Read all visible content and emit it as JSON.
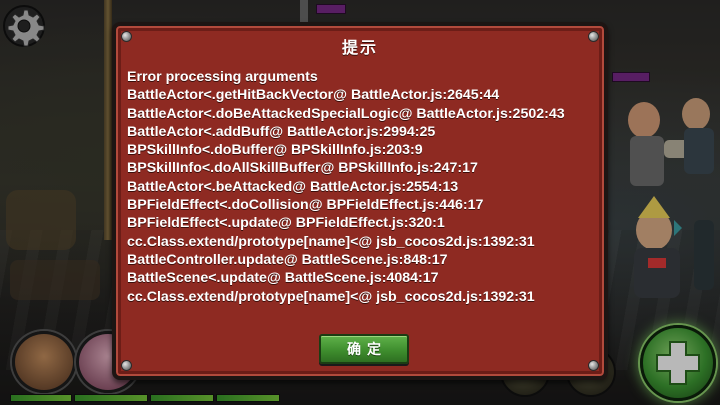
{
  "dialog": {
    "title": "提示",
    "message_lines": [
      "Error processing arguments",
      "BattleActor<.getHitBackVector@ BattleActor.js:2645:44",
      "BattleActor<.doBeAttackedSpecialLogic@ BattleActor.js:2502:43",
      "BattleActor<.addBuff@ BattleActor.js:2994:25",
      "BPSkillInfo<.doBuffer@ BPSkillInfo.js:203:9",
      "BPSkillInfo<.doAllSkillBuffer@ BPSkillInfo.js:247:17",
      "BattleActor<.beAttacked@ BattleActor.js:2554:13",
      "BPFieldEffect<.doCollision@ BPFieldEffect.js:446:17",
      "BPFieldEffect<.update@ BPFieldEffect.js:320:1",
      "cc.Class.extend/prototype[name]<@ jsb_cocos2d.js:1392:31",
      "BattleController.update@ BattleScene.js:848:17",
      "BattleScene<.update@ BattleScene.js:4084:17",
      "cc.Class.extend/prototype[name]<@ jsb_cocos2d.js:1392:31"
    ],
    "ok_label": "确定"
  },
  "hud": {
    "settings_icon": "gear-icon",
    "skill_icon": "plus-cross-icon"
  },
  "colors": {
    "dialog_bg": "#8e2a22",
    "button_green": "#3f8e2e",
    "text": "#ffffff"
  }
}
